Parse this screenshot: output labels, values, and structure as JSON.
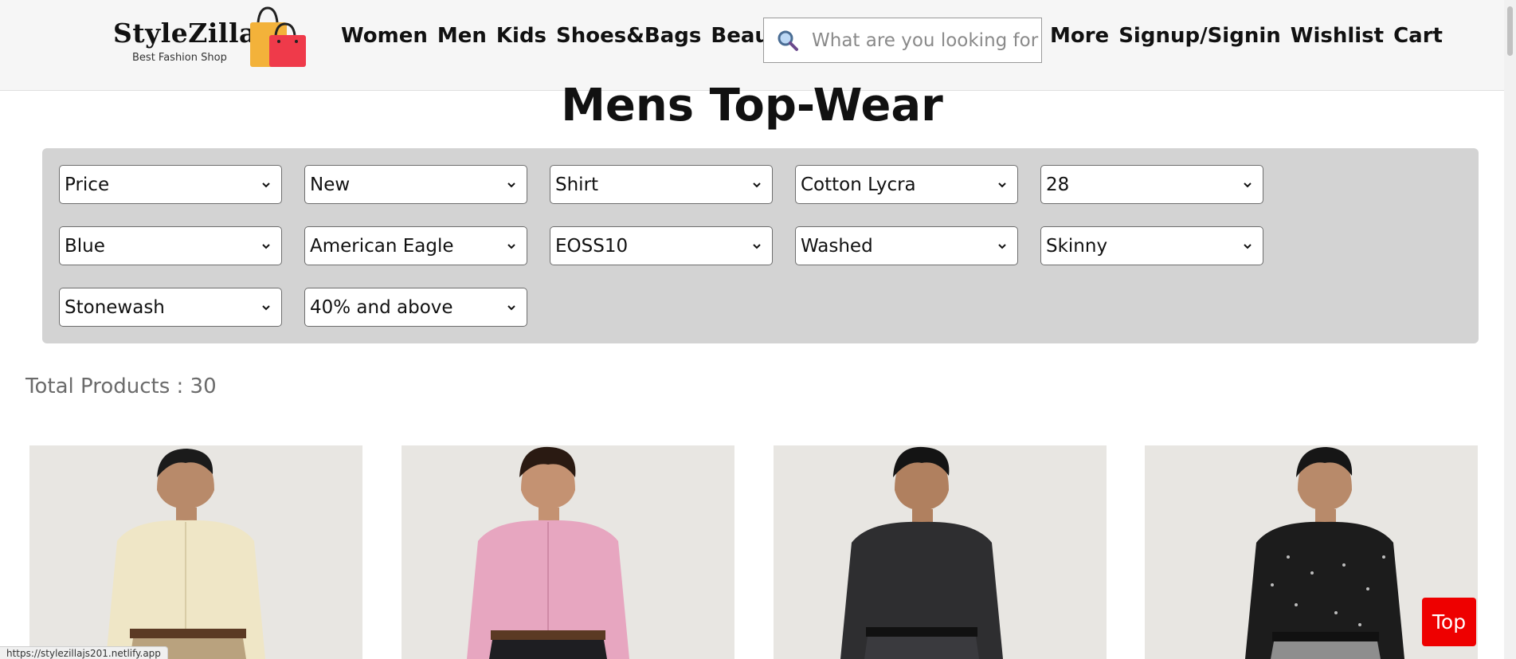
{
  "brand": {
    "name": "StyleZilla",
    "tagline": "Best Fashion Shop",
    "icon": "shopping-bags-logo"
  },
  "nav": {
    "left": [
      "Women",
      "Men",
      "Kids",
      "Shoes&Bags",
      "Beauty"
    ],
    "right": [
      "More",
      "Signup/Signin",
      "Wishlist",
      "Cart"
    ]
  },
  "search": {
    "placeholder": "What are you looking for ?",
    "icon": "search-icon"
  },
  "page": {
    "title": "Mens Top-Wear",
    "total_products": "Total Products : 30"
  },
  "filters": [
    "Price",
    "New",
    "Shirt",
    "Cotton Lycra",
    "28",
    "Blue",
    "American Eagle",
    "EOSS10",
    "Washed",
    "Skinny",
    "Stonewash",
    "40% and above"
  ],
  "products": [
    {
      "image": "man-in-cream-checked-shirt",
      "shirt_color": "#efe6c6"
    },
    {
      "image": "man-in-pink-shirt",
      "shirt_color": "#e7a6c0"
    },
    {
      "image": "man-in-dark-grey-shirt",
      "shirt_color": "#2e2e30"
    },
    {
      "image": "man-in-black-printed-shirt",
      "shirt_color": "#1c1c1c"
    }
  ],
  "top_button": "Top",
  "status_url": "https://stylezillajs201.netlify.app"
}
